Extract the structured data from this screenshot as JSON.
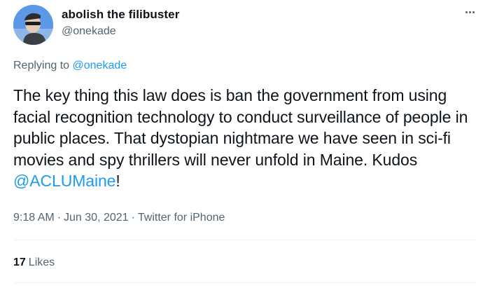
{
  "author": {
    "display_name": "abolish the filibuster",
    "handle": "@onekade"
  },
  "reply": {
    "prefix": "Replying to",
    "mention": "@onekade"
  },
  "tweet": {
    "text_before": "The key thing this law does is ban the government from using facial recognition technology to conduct surveillance of people in public places. That dystopian nightmare we have seen in sci-fi movies and spy thrillers will never unfold in Maine. Kudos ",
    "mention": "@ACLUMaine",
    "text_after": "!"
  },
  "meta": {
    "time": "9:18 AM",
    "separator": "·",
    "date": "Jun 30, 2021",
    "source": "Twitter for iPhone"
  },
  "stats": {
    "likes_count": "17",
    "likes_label": "Likes"
  },
  "icons": {
    "more": "more-horizontal-icon"
  },
  "colors": {
    "link": "#1d9bf0",
    "secondary_text": "#536471",
    "primary_text": "#0f1419"
  }
}
